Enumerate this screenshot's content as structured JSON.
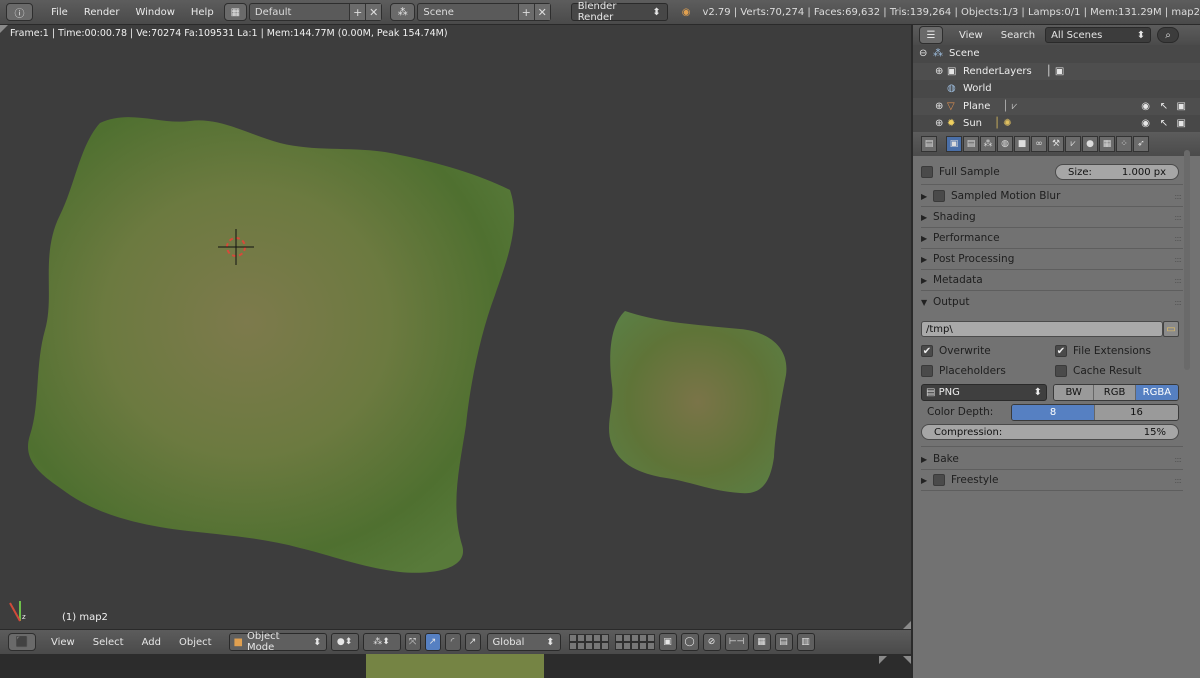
{
  "topbar": {
    "menu": [
      "File",
      "Render",
      "Window",
      "Help"
    ],
    "layout": "Default",
    "scene": "Scene",
    "engine": "Blender Render",
    "stats": "v2.79 | Verts:70,274 | Faces:69,632 | Tris:139,264 | Objects:1/3 | Lamps:0/1 | Mem:131.29M | map2"
  },
  "viewport": {
    "header_info": "Frame:1 | Time:00:00.78 | Ve:70274 Fa:109531 La:1 | Mem:144.77M (0.00M, Peak 154.74M)",
    "object_label": "(1) map2"
  },
  "footer": {
    "menu": [
      "View",
      "Select",
      "Add",
      "Object"
    ],
    "mode": "Object Mode",
    "orientation": "Global"
  },
  "outliner": {
    "view": "View",
    "search": "Search",
    "scenes": "All Scenes",
    "items": [
      {
        "label": "Scene"
      },
      {
        "label": "RenderLayers"
      },
      {
        "label": "World"
      },
      {
        "label": "Plane"
      },
      {
        "label": "Sun"
      }
    ]
  },
  "props": {
    "full_sample": "Full Sample",
    "size_label": "Size:",
    "size_value": "1.000 px",
    "panels": [
      "Sampled Motion Blur",
      "Shading",
      "Performance",
      "Post Processing",
      "Metadata",
      "Output"
    ],
    "output_path": "/tmp\\",
    "overwrite": "Overwrite",
    "file_extensions": "File Extensions",
    "placeholders": "Placeholders",
    "cache_result": "Cache Result",
    "format": "PNG",
    "color_modes": [
      "BW",
      "RGB",
      "RGBA"
    ],
    "color_depth_label": "Color Depth:",
    "depths": [
      "8",
      "16"
    ],
    "compression_label": "Compression:",
    "compression_value": "15%",
    "bake": "Bake",
    "freestyle": "Freestyle"
  },
  "colors": {
    "accent": "#5680c2",
    "terrain_green": "#5a7a36",
    "terrain_tan": "#8a8258"
  }
}
